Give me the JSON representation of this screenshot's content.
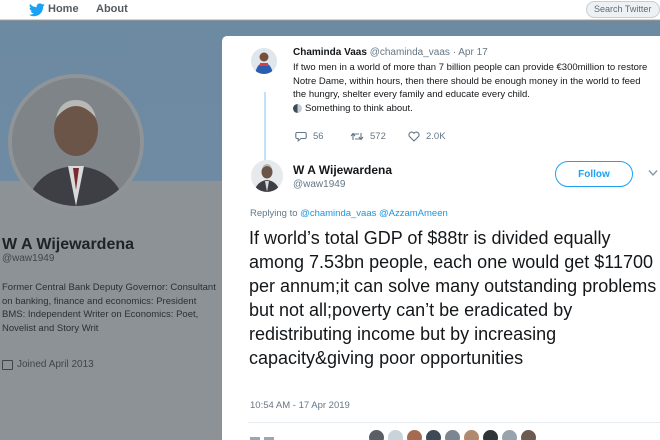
{
  "nav": {
    "home_label": "Home",
    "about_label": "About",
    "search_placeholder": "Search Twitter"
  },
  "profile": {
    "name": "W A Wijewardena",
    "handle": "@waw1949",
    "bio": "Former Central Bank Deputy Governor: Consultant on banking, finance and economics: President BMS: Independent Writer on Economics: Poet, Novelist and Story Writ",
    "joined": "Joined April 2013"
  },
  "parent_tweet": {
    "author_name": "Chaminda Vaas",
    "author_handle": "@chaminda_vaas",
    "date": "Apr 17",
    "text": "If two men in a world of more than 7 billion people can provide €300million to restore Notre Dame, within hours, then there should be enough money in the world to feed the hungry, shelter every family and educate every child.",
    "text_tail": "Something to think about.",
    "replies": "56",
    "retweets": "572",
    "likes": "2.0K"
  },
  "tweet": {
    "author_name": "W A Wijewardena",
    "author_handle": "@waw1949",
    "follow_label": "Follow",
    "replying_prefix": "Replying to",
    "replying_to_1": "@chaminda_vaas",
    "replying_to_2": "@AzzamAmeen",
    "text": "If world’s total GDP of $88tr is divided equally among 7.53bn people, each one would get $11700 per annum;it can solve many outstanding problems but not all;poverty can’t be eradicated by redistributing income but by increasing capacity&giving poor opportunities",
    "timestamp": "10:54 AM - 17 Apr 2019"
  },
  "colors": {
    "twitter_blue": "#1da1f2",
    "link_blue": "#1b95e0",
    "text_dark": "#14171a",
    "text_muted": "#657786"
  },
  "icons": [
    "twitter-bird-icon",
    "reply-icon",
    "retweet-icon",
    "like-icon",
    "calendar-icon",
    "caret-down-icon",
    "moon-emoji-icon"
  ]
}
